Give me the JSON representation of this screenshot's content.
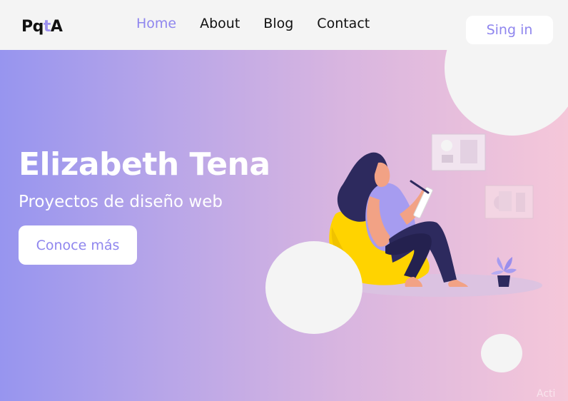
{
  "nav": {
    "logo": {
      "part1": "Pq",
      "accent": "t",
      "part2": "A"
    },
    "links": [
      "Home",
      "About",
      "Blog",
      "Contact"
    ],
    "signin_label": "Sing in"
  },
  "hero": {
    "title": "Elizabeth Tena",
    "subtitle": "Proyectos de diseño web",
    "cta_label": "Conoce más"
  },
  "watermark": "Acti",
  "colors": {
    "accent": "#8f86ee",
    "gradient_start": "#9795ef",
    "gradient_end": "#f5c7d9",
    "chair": "#ffd300",
    "hair_pants": "#2d2a5e"
  },
  "icons": [
    "person-reading-illustration",
    "picture-frame-icon",
    "plant-icon"
  ]
}
